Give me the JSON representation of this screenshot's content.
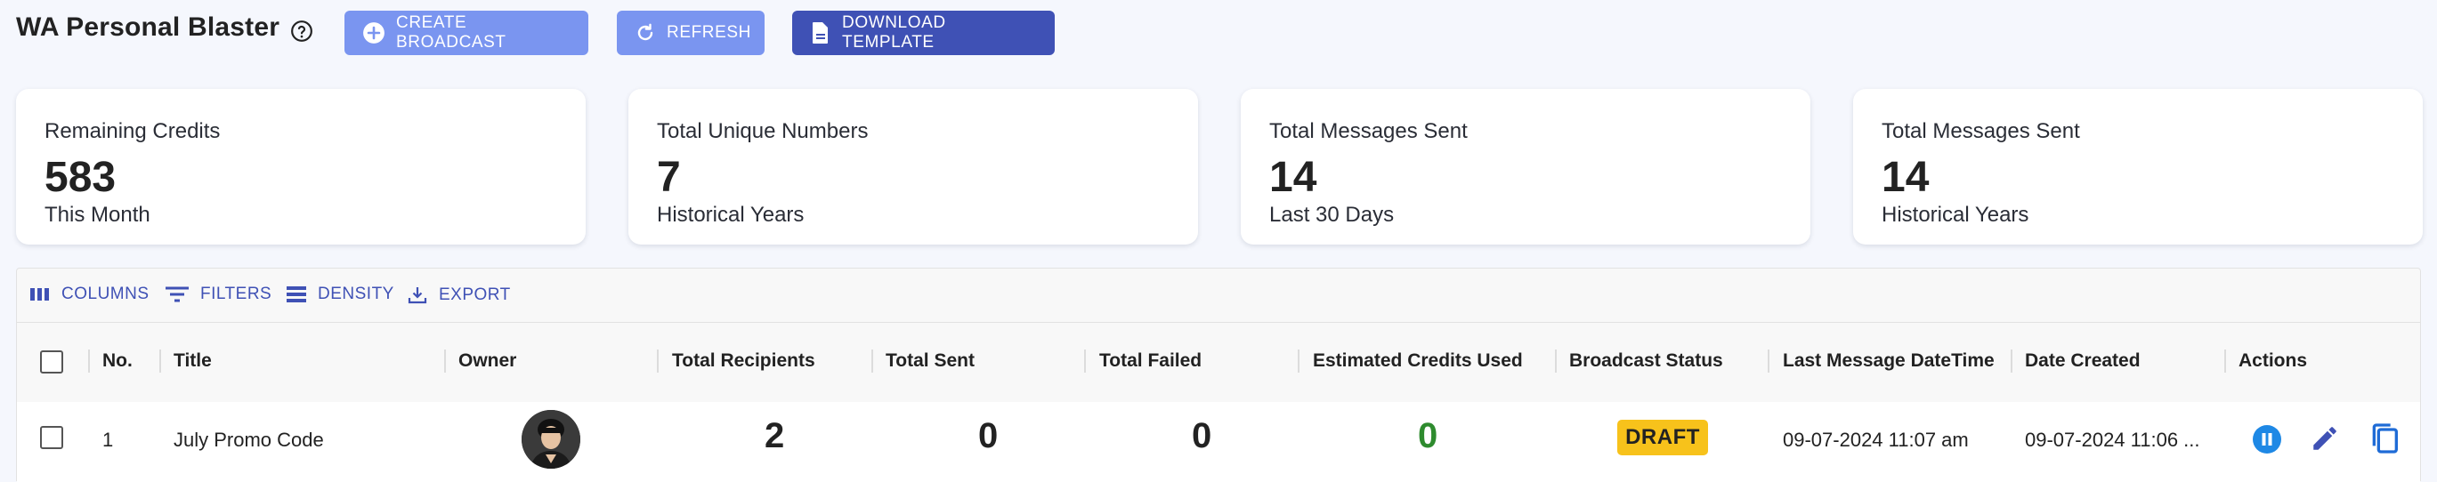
{
  "header": {
    "title": "WA Personal Blaster",
    "buttons": {
      "create": "CREATE BROADCAST",
      "refresh": "REFRESH",
      "download": "DOWNLOAD TEMPLATE"
    }
  },
  "stats": [
    {
      "label": "Remaining Credits",
      "value": "583",
      "sub": "This Month"
    },
    {
      "label": "Total Unique Numbers",
      "value": "7",
      "sub": "Historical Years"
    },
    {
      "label": "Total Messages Sent",
      "value": "14",
      "sub": "Last 30 Days"
    },
    {
      "label": "Total Messages Sent",
      "value": "14",
      "sub": "Historical Years"
    }
  ],
  "toolbar": {
    "columns": "COLUMNS",
    "filters": "FILTERS",
    "density": "DENSITY",
    "export": "EXPORT"
  },
  "table": {
    "columns": [
      "No.",
      "Title",
      "Owner",
      "Total Recipients",
      "Total Sent",
      "Total Failed",
      "Estimated Credits Used",
      "Broadcast Status",
      "Last Message DateTime",
      "Date Created",
      "Actions"
    ],
    "rows": [
      {
        "no": "1",
        "title": "July Promo Code",
        "total_recipients": "2",
        "total_sent": "0",
        "total_failed": "0",
        "estimated_credits": "0",
        "status": "DRAFT",
        "last_message": "09-07-2024 11:07 am",
        "date_created": "09-07-2024 11:06 ..."
      }
    ]
  },
  "colors": {
    "primary": "#3f51b5",
    "primary_light": "#7a95f0",
    "draft_badge": "#f7c21b",
    "credits_green": "#2e8b2e",
    "pause_icon": "#1e88e5"
  },
  "icons": [
    "help-circle-icon",
    "plus-circle-icon",
    "refresh-icon",
    "document-icon",
    "columns-icon",
    "filter-icon",
    "density-icon",
    "export-icon",
    "pause-icon",
    "edit-icon",
    "copy-icon"
  ]
}
